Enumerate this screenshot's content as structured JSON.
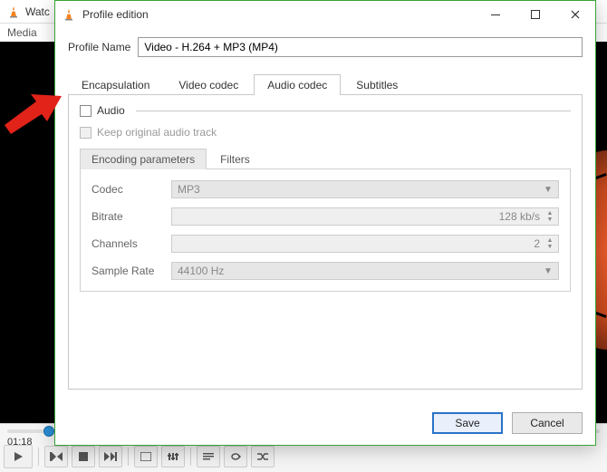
{
  "bg": {
    "title": "Watc",
    "menu": "Media",
    "time": "01:18"
  },
  "dialog": {
    "title": "Profile edition",
    "profile_label": "Profile Name",
    "profile_value": "Video - H.264 + MP3 (MP4)",
    "tabs": {
      "enc": "Encapsulation",
      "video": "Video codec",
      "audio": "Audio codec",
      "subs": "Subtitles"
    },
    "audio_tab": {
      "audio_label": "Audio",
      "keep_label": "Keep original audio track",
      "inner_tabs": {
        "encp": "Encoding parameters",
        "filters": "Filters"
      },
      "params": {
        "codec_label": "Codec",
        "codec_value": "MP3",
        "bitrate_label": "Bitrate",
        "bitrate_value": "128 kb/s",
        "channels_label": "Channels",
        "channels_value": "2",
        "samplerate_label": "Sample Rate",
        "samplerate_value": "44100 Hz"
      }
    },
    "buttons": {
      "save": "Save",
      "cancel": "Cancel"
    }
  }
}
